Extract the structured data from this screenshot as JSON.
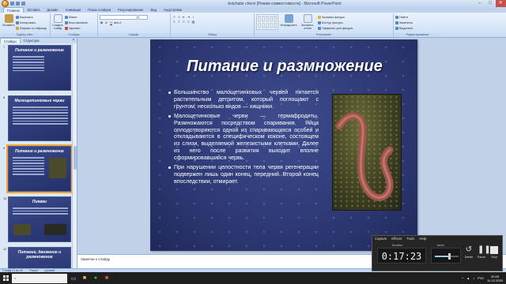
{
  "window": {
    "title": "botchatie chervi [Режим совместимости] - Microsoft PowerPoint",
    "controls": [
      "–",
      "□",
      "✕"
    ]
  },
  "ribbon_tabs": [
    "Главная",
    "Вставка",
    "Дизайн",
    "Анимация",
    "Показ слайдов",
    "Рецензирование",
    "Вид",
    "Надстройки"
  ],
  "ribbon": {
    "clipboard": {
      "paste": "Вставить",
      "cut": "Вырезать",
      "copy": "Копировать",
      "format_painter": "Формат по образцу",
      "label": "Буфер обм..."
    },
    "slides": {
      "create": "Создать слайд",
      "layout": "Макет",
      "restore": "Восстановить",
      "delete": "Удалить",
      "label": "Слайды"
    },
    "font": {
      "name": "",
      "size": "",
      "label": "Шрифт"
    },
    "paragraph": {
      "label": "Абзац"
    },
    "drawing": {
      "arrange": "Упорядочить",
      "quick_styles": "Экспресс-стили",
      "label": "Рисование"
    },
    "shape_opts": {
      "fill": "Заливка фигуры",
      "outline": "Контур фигуры",
      "effects": "Эффекты для фигуры"
    },
    "editing": {
      "find": "Найти",
      "replace": "Заменить",
      "select": "Выделить",
      "label": "Редактирование"
    }
  },
  "left_panel": {
    "tabs": [
      "Слайды",
      "Структура"
    ],
    "close": "×",
    "thumbnails": [
      {
        "num": "7",
        "title": "Питание и размножение"
      },
      {
        "num": "8",
        "title": "Малощетинковые черви"
      },
      {
        "num": "9",
        "title": "Питание и размножение"
      },
      {
        "num": "10",
        "title": "Пиявки"
      },
      {
        "num": "11",
        "title": "Питание, движение и размножение"
      }
    ]
  },
  "slide": {
    "title": "Питание и размножение",
    "bullets": [
      "Большинство малощетинковых червей питается растительным детритом, который поглощают с грунтом; несколько видов — хищники.",
      "Малощетинковые черви — гермафродиты. Размножаются посредством спаривания. Яйца оплодотворяются одной из спаривающихся особей и откладываются в специфическом коконе, состоящем из слизи, выделяемой железистыми клетками. Далее из него после развития выходит вполне сформировавшийся червь.",
      "При нарушении целостности тела червя регенерации подвержен лишь один конец, передний. Второй конец впоследствии, отмирает."
    ]
  },
  "notes": {
    "placeholder": "Заметки к слайду"
  },
  "statusbar": {
    "slide": "Слайд 13 из 16",
    "theme": "\"Точка\"",
    "lang": "русский",
    "zoom": ""
  },
  "taskbar": {
    "search": "",
    "clock_time": "20:29",
    "clock_date": "11.12.2020",
    "lang": "РУС"
  },
  "recorder": {
    "menu": [
      "Capture",
      "Effects",
      "Tools",
      "Help"
    ],
    "duration_label": "Duration",
    "audio_label": "Audio",
    "time": "0:17:23",
    "audio_level": 0.6,
    "buttons": [
      "Delete",
      "Pause",
      "Stop"
    ]
  }
}
